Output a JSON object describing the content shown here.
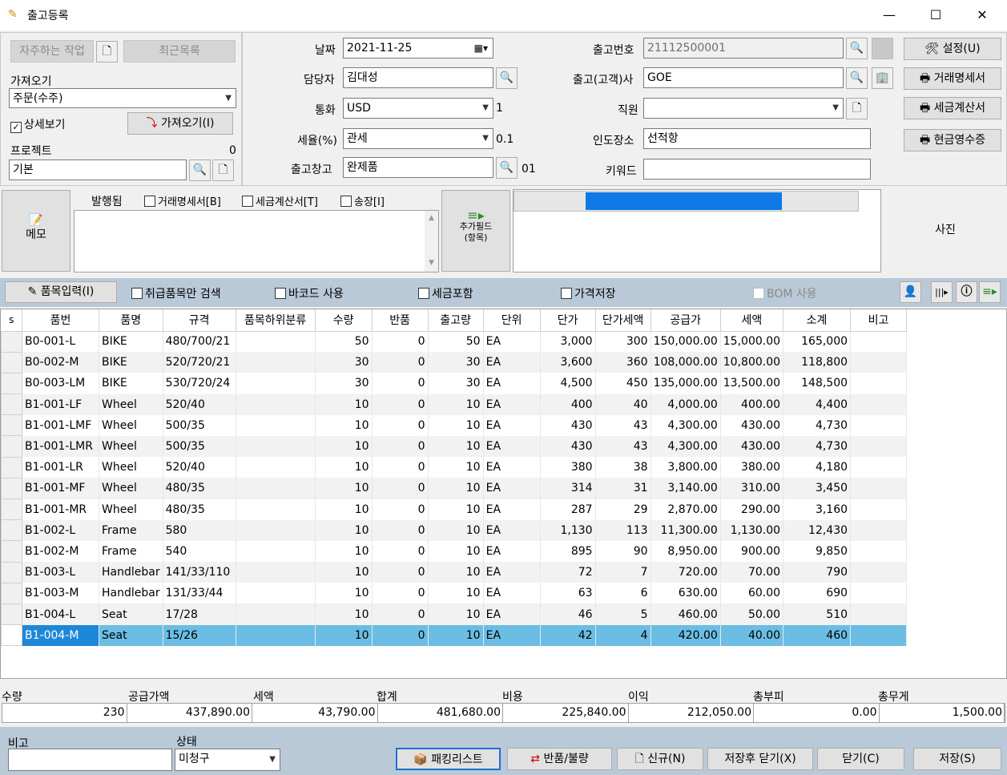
{
  "window": {
    "title": "출고등록",
    "minimize": "—",
    "maximize": "☐",
    "close": "✕"
  },
  "left": {
    "frequent_btn": "자주하는 작업",
    "recent_btn": "최근목록",
    "import_label": "가져오기",
    "import_value": "주문(수주)",
    "detail_view": "상세보기",
    "import_btn": "가져오기(I)",
    "project_label": "프로젝트",
    "project_count": "0",
    "project_value": "기본"
  },
  "mid": {
    "date_label": "날짜",
    "date_value": "2021-11-25",
    "manager_label": "담당자",
    "manager_value": "김대성",
    "currency_label": "통화",
    "currency_value": "USD",
    "currency_rate": "1",
    "tax_label": "세율(%)",
    "tax_value": "관세",
    "tax_rate": "0.1",
    "warehouse_label": "출고창고",
    "warehouse_value": "완제품",
    "warehouse_code": "01"
  },
  "right": {
    "out_no_label": "출고번호",
    "out_no_value": "21112500001",
    "customer_label": "출고(고객)사",
    "customer_value": "GOE",
    "staff_label": "직원",
    "staff_value": "",
    "delivery_label": "인도장소",
    "delivery_value": "선적항",
    "keyword_label": "키워드",
    "keyword_value": ""
  },
  "actions": {
    "settings": "설정(U)",
    "statement": "거래명세서",
    "tax_invoice": "세금계산서",
    "cash_receipt": "현금영수증"
  },
  "memo": {
    "memo_btn": "메모",
    "issued_label": "발행됨",
    "chk_statement": "거래명세서[B]",
    "chk_invoice": "세금계산서[T]",
    "chk_shipping": "송장[I]",
    "extra_field_line1": "추가필드",
    "extra_field_line2": "(항목)",
    "photo": "사진",
    "progress": 0.73
  },
  "toolbar": {
    "item_input": "품목입력(I)",
    "handled_only": "취급품목만 검색",
    "barcode": "바코드 사용",
    "tax_included": "세금포함",
    "price_save": "가격저장",
    "bom": "BOM 사용"
  },
  "table": {
    "headers": [
      "s",
      "품번",
      "품명",
      "규격",
      "품목하위분류",
      "수량",
      "반품",
      "출고량",
      "단위",
      "단가",
      "단가세액",
      "공급가",
      "세액",
      "소계",
      "비고"
    ],
    "rows": [
      [
        "",
        "B0-001-L",
        "BIKE",
        "480/700/21",
        "",
        "50",
        "0",
        "50",
        "EA",
        "3,000",
        "300",
        "150,000.00",
        "15,000.00",
        "165,000",
        ""
      ],
      [
        "",
        "B0-002-M",
        "BIKE",
        "520/720/21",
        "",
        "30",
        "0",
        "30",
        "EA",
        "3,600",
        "360",
        "108,000.00",
        "10,800.00",
        "118,800",
        ""
      ],
      [
        "",
        "B0-003-LM",
        "BIKE",
        "530/720/24",
        "",
        "30",
        "0",
        "30",
        "EA",
        "4,500",
        "450",
        "135,000.00",
        "13,500.00",
        "148,500",
        ""
      ],
      [
        "",
        "B1-001-LF",
        "Wheel",
        "520/40",
        "",
        "10",
        "0",
        "10",
        "EA",
        "400",
        "40",
        "4,000.00",
        "400.00",
        "4,400",
        ""
      ],
      [
        "",
        "B1-001-LMF",
        "Wheel",
        "500/35",
        "",
        "10",
        "0",
        "10",
        "EA",
        "430",
        "43",
        "4,300.00",
        "430.00",
        "4,730",
        ""
      ],
      [
        "",
        "B1-001-LMR",
        "Wheel",
        "500/35",
        "",
        "10",
        "0",
        "10",
        "EA",
        "430",
        "43",
        "4,300.00",
        "430.00",
        "4,730",
        ""
      ],
      [
        "",
        "B1-001-LR",
        "Wheel",
        "520/40",
        "",
        "10",
        "0",
        "10",
        "EA",
        "380",
        "38",
        "3,800.00",
        "380.00",
        "4,180",
        ""
      ],
      [
        "",
        "B1-001-MF",
        "Wheel",
        "480/35",
        "",
        "10",
        "0",
        "10",
        "EA",
        "314",
        "31",
        "3,140.00",
        "310.00",
        "3,450",
        ""
      ],
      [
        "",
        "B1-001-MR",
        "Wheel",
        "480/35",
        "",
        "10",
        "0",
        "10",
        "EA",
        "287",
        "29",
        "2,870.00",
        "290.00",
        "3,160",
        ""
      ],
      [
        "",
        "B1-002-L",
        "Frame",
        "580",
        "",
        "10",
        "0",
        "10",
        "EA",
        "1,130",
        "113",
        "11,300.00",
        "1,130.00",
        "12,430",
        ""
      ],
      [
        "",
        "B1-002-M",
        "Frame",
        "540",
        "",
        "10",
        "0",
        "10",
        "EA",
        "895",
        "90",
        "8,950.00",
        "900.00",
        "9,850",
        ""
      ],
      [
        "",
        "B1-003-L",
        "Handlebar",
        "141/33/110",
        "",
        "10",
        "0",
        "10",
        "EA",
        "72",
        "7",
        "720.00",
        "70.00",
        "790",
        ""
      ],
      [
        "",
        "B1-003-M",
        "Handlebar",
        "131/33/44",
        "",
        "10",
        "0",
        "10",
        "EA",
        "63",
        "6",
        "630.00",
        "60.00",
        "690",
        ""
      ],
      [
        "",
        "B1-004-L",
        "Seat",
        "17/28",
        "",
        "10",
        "0",
        "10",
        "EA",
        "46",
        "5",
        "460.00",
        "50.00",
        "510",
        ""
      ],
      [
        "",
        "B1-004-M",
        "Seat",
        "15/26",
        "",
        "10",
        "0",
        "10",
        "EA",
        "42",
        "4",
        "420.00",
        "40.00",
        "460",
        ""
      ]
    ]
  },
  "totals": {
    "labels": [
      "수량",
      "공급가액",
      "세액",
      "합계",
      "비용",
      "이익",
      "총부피",
      "총무게"
    ],
    "values": [
      "230",
      "437,890.00",
      "43,790.00",
      "481,680.00",
      "225,840.00",
      "212,050.00",
      "0.00",
      "1,500.00"
    ]
  },
  "bottom": {
    "note_label": "비고",
    "status_label": "상태",
    "status_value": "미청구",
    "packing": "패킹리스트",
    "return": "반품/불량",
    "new": "신규(N)",
    "save_close": "저장후 닫기(X)",
    "close": "닫기(C)",
    "save": "저장(S)"
  }
}
